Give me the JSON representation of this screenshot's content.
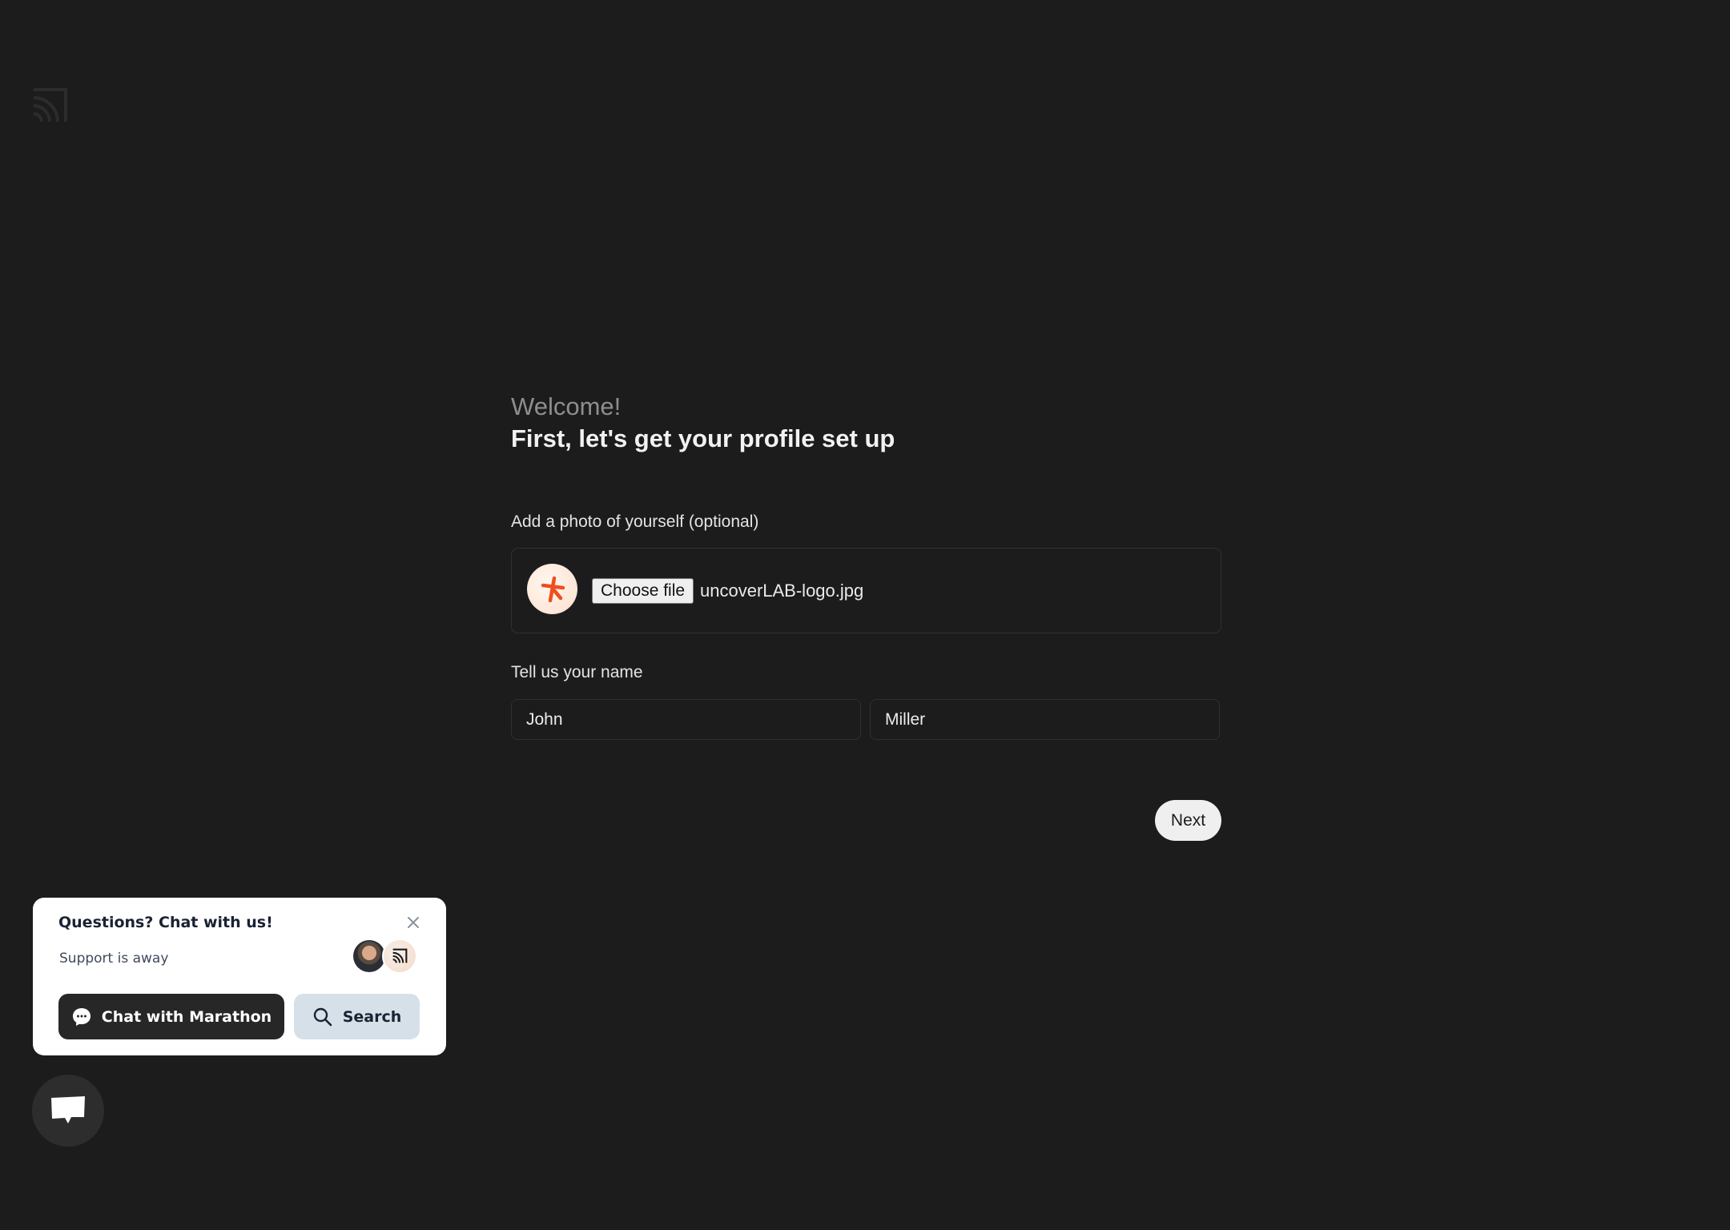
{
  "app": {
    "logo_icon": "brand-logo-icon"
  },
  "onboarding": {
    "welcome": "Welcome!",
    "headline": "First, let's get your profile set up",
    "photo": {
      "label": "Add a photo of yourself (optional)",
      "choose_file_label": "Choose file",
      "file_name": "uncoverLAB-logo.jpg",
      "preview_icon": "asterisk-logo-icon",
      "accent_color": "#f04e1e"
    },
    "name": {
      "label": "Tell us your name",
      "first_name": "John",
      "last_name": "Miller"
    },
    "next_label": "Next"
  },
  "chat_widget": {
    "title": "Questions? Chat with us!",
    "status": "Support is away",
    "chat_button_label": "Chat with Marathon",
    "search_button_label": "Search",
    "close_icon": "close-icon",
    "launcher_icon": "chat-bubble-icon"
  }
}
